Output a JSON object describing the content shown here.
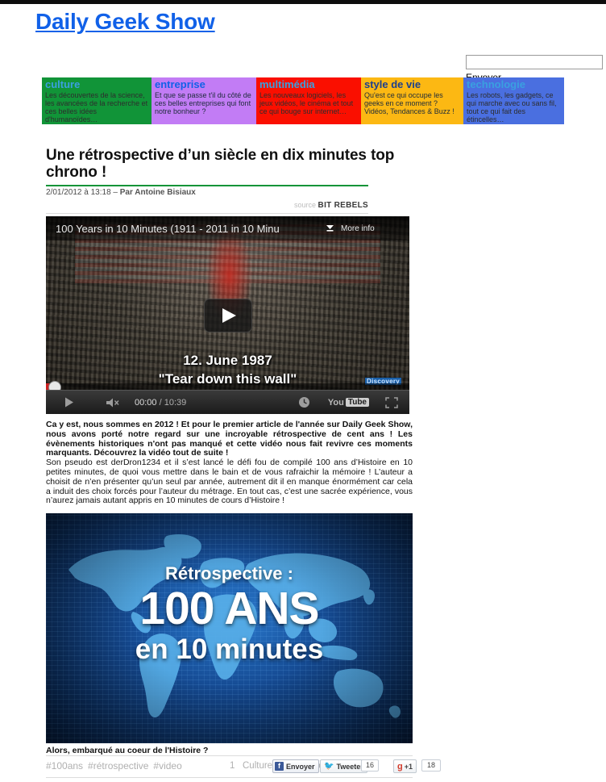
{
  "site": {
    "logo_text": "Daily Geek Show",
    "top_bar_color": "#0d0d0d"
  },
  "search": {
    "value": "",
    "placeholder": "",
    "submit_label": "Envoyer"
  },
  "nav": {
    "items": [
      {
        "title": "culture",
        "desc": "Les découvertes de la science, les avancées de la recherche et ces belles idées d'humanoïdes…",
        "color": "#119438"
      },
      {
        "title": "entreprise",
        "desc": "Et que se passe t'il du côté de ces belles entreprises qui font notre bonheur ?",
        "color": "#c27cf5"
      },
      {
        "title": "multimédia",
        "desc": "Les nouveaux logiciels, les jeux vidéos, le cinéma et tout ce qui bouge sur internet…",
        "color": "#fa0f00"
      },
      {
        "title": "style de vie",
        "desc": "Qu'est ce qui occupe les geeks en ce moment ? Vidéos, Tendances & Buzz !",
        "color": "#fcb813"
      },
      {
        "title": "technologie",
        "desc": "Les robots, les gadgets, ce qui marche avec ou sans fil, tout ce qui fait des étincelles…",
        "color": "#4a6fe0"
      }
    ]
  },
  "article": {
    "title": "Une rétrospective d’un siècle en dix minutes top chrono !",
    "date": "2/01/2012 à 13:18 – ",
    "author": "Par Antoine Bisiaux",
    "source_label": "source",
    "source_name": "BIT REBELS",
    "rule_color": "#119438",
    "paragraph_1": "Ca y est, nous sommes en 2012 ! Et pour le premier article de l'année sur Daily Geek Show, nous avons porté notre regard sur une incroyable rétrospective de cent ans ! Les évènements historiques n'ont pas manqué et cette vidéo nous fait revivre ces moments marquants. Découvrez la vidéo tout de suite !",
    "paragraph_2": "Son pseudo est derDron1234 et il s’est lancé le défi fou de compilé 100 ans d’Histoire en 10 petites minutes, de quoi vous mettre dans le bain et de vous rafraichir la mémoire ! L’auteur a choisit de n’en présenter qu’un seul par année, autrement dit il en manque énormément car cela a induit des choix forcés pour l’auteur du métrage. En tout cas, c’est une sacrée expérience, vous n’aurez jamais autant appris en 10 minutes de cours d’Histoire !",
    "illustration_caption": "Alors, embarqué au coeur de l'Histoire ?"
  },
  "player": {
    "video_title": "100 Years in 10 Minutes (1911 - 2011 in 10 Minu",
    "more_info_label": "More info",
    "more_info_icon": "chevron-down-icon",
    "play_icon": "play-icon",
    "mute_icon": "mute-icon",
    "clock_icon": "clock-icon",
    "fullscreen_icon": "fullscreen-icon",
    "current_time": "00:00",
    "time_separator": " / ",
    "duration": "10:39",
    "yt_you": "You",
    "yt_tube": "Tube",
    "caption_line1": "12. June 1987",
    "caption_line2": "\"Tear down this wall\"",
    "channel_watermark": "Discovery"
  },
  "illustration": {
    "line1": "Rétrospective :",
    "line2": "100 ANS",
    "line3": "en 10 minutes"
  },
  "footer": {
    "tags": [
      "#100ans",
      "#rétrospective",
      "#video"
    ],
    "comment_count": "1",
    "categories": "Culture Science Vidéos",
    "facebook_label": "Envoyer",
    "facebook_mark": "f",
    "twitter_label": "Tweeter",
    "twitter_count": "16",
    "google_label": "+1",
    "google_mark": "g",
    "google_count": "18"
  }
}
